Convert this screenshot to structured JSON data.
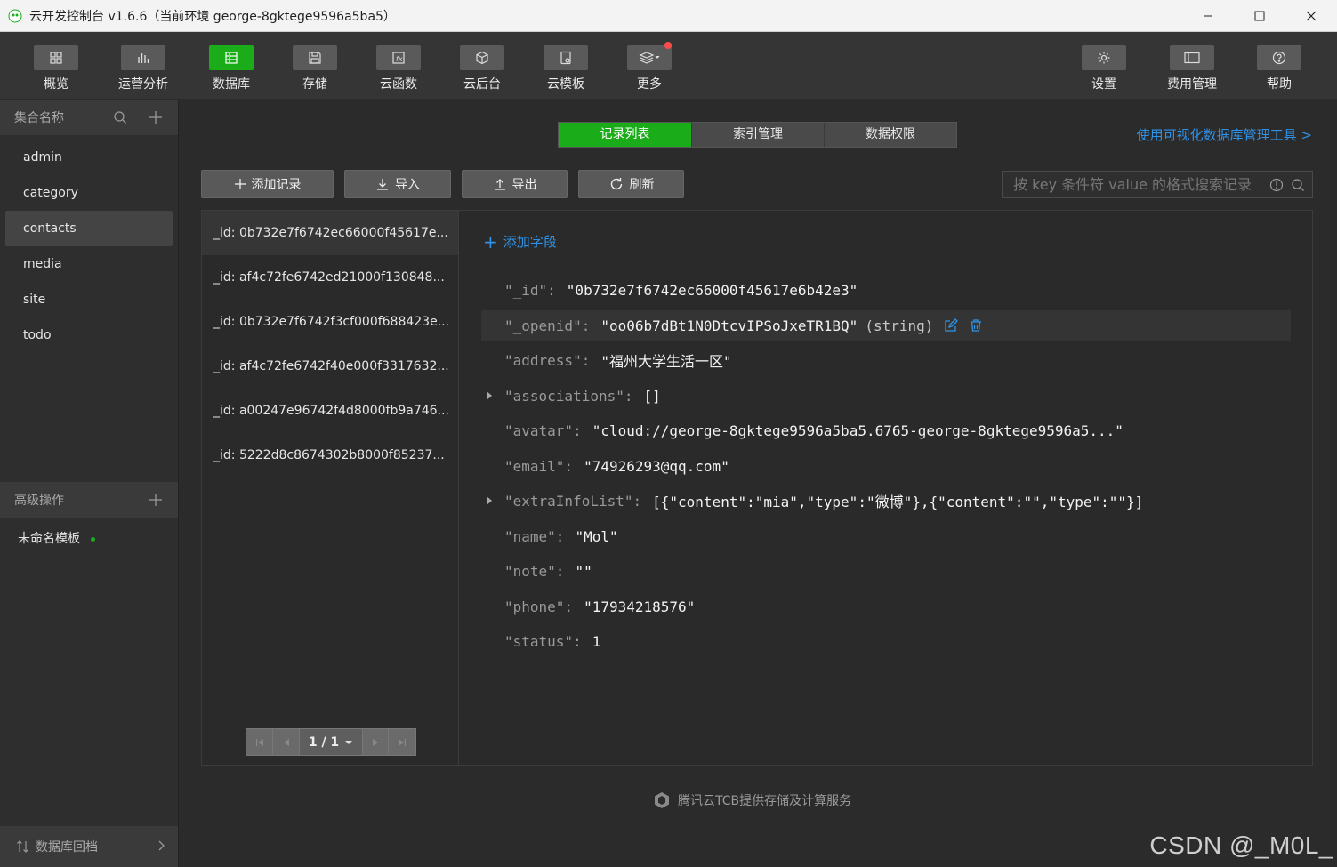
{
  "window": {
    "title": "云开发控制台 v1.6.6（当前环境 george-8gktege9596a5ba5）"
  },
  "toolbar": {
    "left": [
      {
        "label": "概览",
        "icon": "grid-icon"
      },
      {
        "label": "运营分析",
        "icon": "bar-chart-icon"
      },
      {
        "label": "数据库",
        "icon": "database-icon"
      },
      {
        "label": "存储",
        "icon": "save-icon"
      },
      {
        "label": "云函数",
        "icon": "function-icon"
      },
      {
        "label": "云后台",
        "icon": "cube-icon"
      },
      {
        "label": "云模板",
        "icon": "template-icon"
      },
      {
        "label": "更多",
        "icon": "layers-icon"
      }
    ],
    "right": [
      {
        "label": "设置",
        "icon": "gear-icon"
      },
      {
        "label": "费用管理",
        "icon": "wallet-icon"
      },
      {
        "label": "帮助",
        "icon": "help-icon"
      }
    ],
    "active": "数据库"
  },
  "sidebar": {
    "collections_header": "集合名称",
    "collections": [
      "admin",
      "category",
      "contacts",
      "media",
      "site",
      "todo"
    ],
    "active_collection": "contacts",
    "advanced_header": "高级操作",
    "template_item": "未命名模板",
    "footer": "数据库回档"
  },
  "main": {
    "tabs": [
      {
        "label": "记录列表",
        "active": true
      },
      {
        "label": "索引管理",
        "active": false
      },
      {
        "label": "数据权限",
        "active": false
      }
    ],
    "visual_tool_link": "使用可视化数据库管理工具 >",
    "actions": {
      "add": "添加记录",
      "import": "导入",
      "export": "导出",
      "refresh": "刷新"
    },
    "search_placeholder": "按 key 条件符 value 的格式搜索记录",
    "records": [
      "_id: 0b732e7f6742ec66000f45617e...",
      "_id: af4c72fe6742ed21000f130848...",
      "_id: 0b732e7f6742f3cf000f688423e...",
      "_id: af4c72fe6742f40e000f3317632...",
      "_id: a00247e96742f4d8000fb9a746...",
      "_id: 5222d8c8674302b8000f85237..."
    ],
    "pager": "1 / 1",
    "add_field": "添加字段",
    "fields": [
      {
        "key": "\"_id\":",
        "value": "\"0b732e7f6742ec66000f45617e6b42e3\"",
        "type": "",
        "expandable": false
      },
      {
        "key": "\"_openid\":",
        "value": "\"oo06b7dBt1N0DtcvIPSoJxeTR1BQ\"",
        "type": "(string)",
        "expandable": false
      },
      {
        "key": "\"address\":",
        "value": "\"福州大学生活一区\"",
        "type": "",
        "expandable": false
      },
      {
        "key": "\"associations\":",
        "value": "[]",
        "type": "",
        "expandable": true
      },
      {
        "key": "\"avatar\":",
        "value": "\"cloud://george-8gktege9596a5ba5.6765-george-8gktege9596a5...\"",
        "type": "",
        "expandable": false
      },
      {
        "key": "\"email\":",
        "value": "\"74926293@qq.com\"",
        "type": "",
        "expandable": false
      },
      {
        "key": "\"extraInfoList\":",
        "value": "[{\"content\":\"mia\",\"type\":\"微博\"},{\"content\":\"\",\"type\":\"\"}]",
        "type": "",
        "expandable": true
      },
      {
        "key": "\"name\":",
        "value": "\"Mol\"",
        "type": "",
        "expandable": false
      },
      {
        "key": "\"note\":",
        "value": "\"\"",
        "type": "",
        "expandable": false
      },
      {
        "key": "\"phone\":",
        "value": "\"17934218576\"",
        "type": "",
        "expandable": false
      },
      {
        "key": "\"status\":",
        "value": "1",
        "type": "",
        "expandable": false
      }
    ],
    "footer": "腾讯云TCB提供存储及计算服务"
  },
  "watermark": "CSDN @_M0L_",
  "colors": {
    "accent_green": "#1aad19",
    "link_blue": "#2f93e8",
    "notification_red": "#fa4b4b"
  }
}
